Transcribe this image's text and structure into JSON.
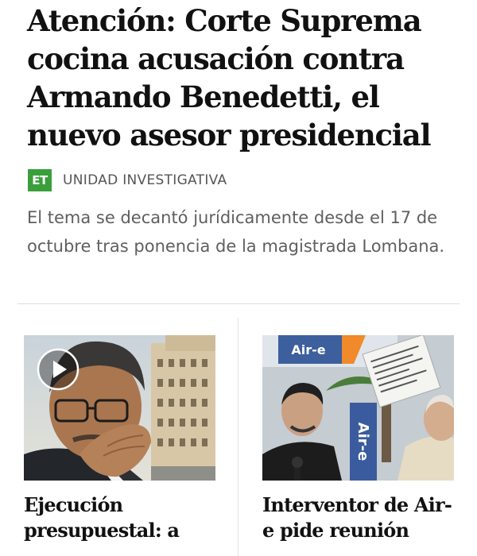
{
  "article": {
    "headline": "Atención: Corte Suprema cocina acusación contra Armando Benedetti, el nuevo asesor presidencial",
    "section_logo": "ET",
    "section_label": "UNIDAD INVESTIGATIVA",
    "lede": "El tema se decantó jurídicamente desde el 17 de octubre tras ponencia de la magistrada Lombana."
  },
  "related": [
    {
      "title": "Ejecución presupuestal: a",
      "has_video": true
    },
    {
      "title": "Interventor de Air-e pide reunión",
      "sign_text": "Air-e",
      "paper_text": "UNIDAD INVESTIGATIVA"
    }
  ],
  "colors": {
    "brand_green": "#3a9f3a",
    "text_dark": "#111111",
    "text_muted": "#5f5f5f"
  }
}
